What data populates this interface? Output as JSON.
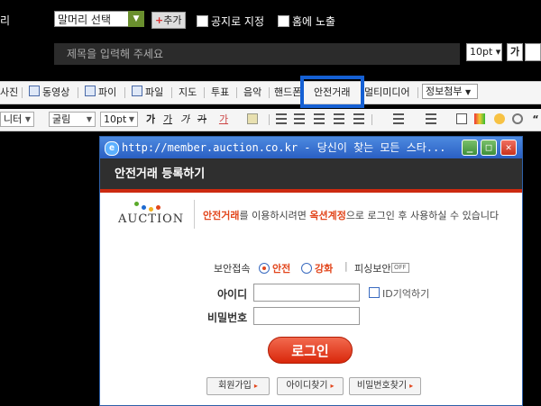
{
  "header": {
    "left_label": "리",
    "category_select": "말머리 선택",
    "add_button": "추가",
    "add_symbol": "+",
    "notice_label": "공지로 지정",
    "home_label": "홈에 노출",
    "title_placeholder": "제목을 입력해 주세요",
    "font_size": "10pt",
    "bold_label": "가"
  },
  "toolbar1": {
    "items": [
      "사진",
      "동영상",
      "파이",
      "파일",
      "지도",
      "투표",
      "음악",
      "핸드폰",
      "안전거래",
      "멀티미디어"
    ],
    "info_dropdown": "정보첨부",
    "highlighted": "안전거래"
  },
  "toolbar2": {
    "font_dropdown": "니터",
    "face_dropdown": "굴림",
    "size_dropdown": "10pt",
    "format_buttons": [
      "가",
      "가",
      "가",
      "가",
      "가"
    ]
  },
  "popup": {
    "window_title": "http://member.auction.co.kr - 당신이 찾는 모든 스타...",
    "heading": "안전거래 등록하기",
    "logo_text": "AUCTION",
    "message_prefix": "안전거래",
    "message_mid": "를 이용하시려면 ",
    "message_account": "옥션계정",
    "message_suffix": "으로 로그인 후 사용하실 수 있습니다",
    "security_label": "보안접속",
    "security_safe": "안전",
    "security_strong": "강화",
    "phishing_label": "피싱보안",
    "phishing_state": "OFF",
    "id_label": "아이디",
    "remember_id": "ID기억하기",
    "password_label": "비밀번호",
    "login_button": "로그인",
    "signup_button": "회원가입",
    "find_id_button": "아이디찾기",
    "find_pw_button": "비밀번호찾기"
  },
  "colors": {
    "highlight_border": "#1560d4",
    "brand_red": "#e2461c",
    "title_bar": "#2a5fc3"
  }
}
